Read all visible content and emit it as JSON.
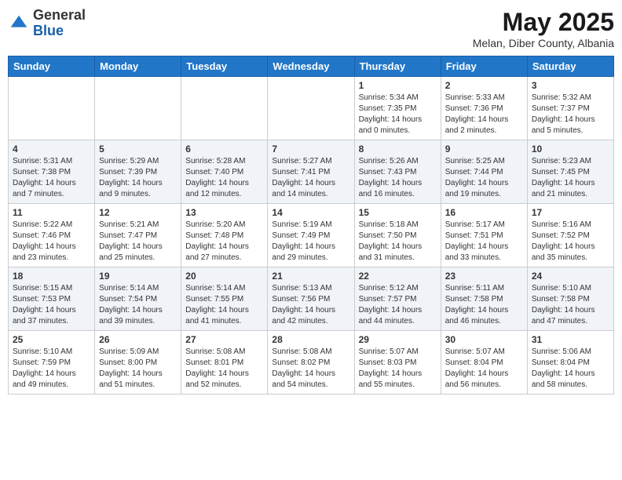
{
  "header": {
    "logo": {
      "general": "General",
      "blue": "Blue"
    },
    "title": "May 2025",
    "subtitle": "Melan, Diber County, Albania"
  },
  "days_of_week": [
    "Sunday",
    "Monday",
    "Tuesday",
    "Wednesday",
    "Thursday",
    "Friday",
    "Saturday"
  ],
  "weeks": [
    [
      {
        "day": "",
        "info": ""
      },
      {
        "day": "",
        "info": ""
      },
      {
        "day": "",
        "info": ""
      },
      {
        "day": "",
        "info": ""
      },
      {
        "day": "1",
        "info": "Sunrise: 5:34 AM\nSunset: 7:35 PM\nDaylight: 14 hours\nand 0 minutes."
      },
      {
        "day": "2",
        "info": "Sunrise: 5:33 AM\nSunset: 7:36 PM\nDaylight: 14 hours\nand 2 minutes."
      },
      {
        "day": "3",
        "info": "Sunrise: 5:32 AM\nSunset: 7:37 PM\nDaylight: 14 hours\nand 5 minutes."
      }
    ],
    [
      {
        "day": "4",
        "info": "Sunrise: 5:31 AM\nSunset: 7:38 PM\nDaylight: 14 hours\nand 7 minutes."
      },
      {
        "day": "5",
        "info": "Sunrise: 5:29 AM\nSunset: 7:39 PM\nDaylight: 14 hours\nand 9 minutes."
      },
      {
        "day": "6",
        "info": "Sunrise: 5:28 AM\nSunset: 7:40 PM\nDaylight: 14 hours\nand 12 minutes."
      },
      {
        "day": "7",
        "info": "Sunrise: 5:27 AM\nSunset: 7:41 PM\nDaylight: 14 hours\nand 14 minutes."
      },
      {
        "day": "8",
        "info": "Sunrise: 5:26 AM\nSunset: 7:43 PM\nDaylight: 14 hours\nand 16 minutes."
      },
      {
        "day": "9",
        "info": "Sunrise: 5:25 AM\nSunset: 7:44 PM\nDaylight: 14 hours\nand 19 minutes."
      },
      {
        "day": "10",
        "info": "Sunrise: 5:23 AM\nSunset: 7:45 PM\nDaylight: 14 hours\nand 21 minutes."
      }
    ],
    [
      {
        "day": "11",
        "info": "Sunrise: 5:22 AM\nSunset: 7:46 PM\nDaylight: 14 hours\nand 23 minutes."
      },
      {
        "day": "12",
        "info": "Sunrise: 5:21 AM\nSunset: 7:47 PM\nDaylight: 14 hours\nand 25 minutes."
      },
      {
        "day": "13",
        "info": "Sunrise: 5:20 AM\nSunset: 7:48 PM\nDaylight: 14 hours\nand 27 minutes."
      },
      {
        "day": "14",
        "info": "Sunrise: 5:19 AM\nSunset: 7:49 PM\nDaylight: 14 hours\nand 29 minutes."
      },
      {
        "day": "15",
        "info": "Sunrise: 5:18 AM\nSunset: 7:50 PM\nDaylight: 14 hours\nand 31 minutes."
      },
      {
        "day": "16",
        "info": "Sunrise: 5:17 AM\nSunset: 7:51 PM\nDaylight: 14 hours\nand 33 minutes."
      },
      {
        "day": "17",
        "info": "Sunrise: 5:16 AM\nSunset: 7:52 PM\nDaylight: 14 hours\nand 35 minutes."
      }
    ],
    [
      {
        "day": "18",
        "info": "Sunrise: 5:15 AM\nSunset: 7:53 PM\nDaylight: 14 hours\nand 37 minutes."
      },
      {
        "day": "19",
        "info": "Sunrise: 5:14 AM\nSunset: 7:54 PM\nDaylight: 14 hours\nand 39 minutes."
      },
      {
        "day": "20",
        "info": "Sunrise: 5:14 AM\nSunset: 7:55 PM\nDaylight: 14 hours\nand 41 minutes."
      },
      {
        "day": "21",
        "info": "Sunrise: 5:13 AM\nSunset: 7:56 PM\nDaylight: 14 hours\nand 42 minutes."
      },
      {
        "day": "22",
        "info": "Sunrise: 5:12 AM\nSunset: 7:57 PM\nDaylight: 14 hours\nand 44 minutes."
      },
      {
        "day": "23",
        "info": "Sunrise: 5:11 AM\nSunset: 7:58 PM\nDaylight: 14 hours\nand 46 minutes."
      },
      {
        "day": "24",
        "info": "Sunrise: 5:10 AM\nSunset: 7:58 PM\nDaylight: 14 hours\nand 47 minutes."
      }
    ],
    [
      {
        "day": "25",
        "info": "Sunrise: 5:10 AM\nSunset: 7:59 PM\nDaylight: 14 hours\nand 49 minutes."
      },
      {
        "day": "26",
        "info": "Sunrise: 5:09 AM\nSunset: 8:00 PM\nDaylight: 14 hours\nand 51 minutes."
      },
      {
        "day": "27",
        "info": "Sunrise: 5:08 AM\nSunset: 8:01 PM\nDaylight: 14 hours\nand 52 minutes."
      },
      {
        "day": "28",
        "info": "Sunrise: 5:08 AM\nSunset: 8:02 PM\nDaylight: 14 hours\nand 54 minutes."
      },
      {
        "day": "29",
        "info": "Sunrise: 5:07 AM\nSunset: 8:03 PM\nDaylight: 14 hours\nand 55 minutes."
      },
      {
        "day": "30",
        "info": "Sunrise: 5:07 AM\nSunset: 8:04 PM\nDaylight: 14 hours\nand 56 minutes."
      },
      {
        "day": "31",
        "info": "Sunrise: 5:06 AM\nSunset: 8:04 PM\nDaylight: 14 hours\nand 58 minutes."
      }
    ]
  ]
}
